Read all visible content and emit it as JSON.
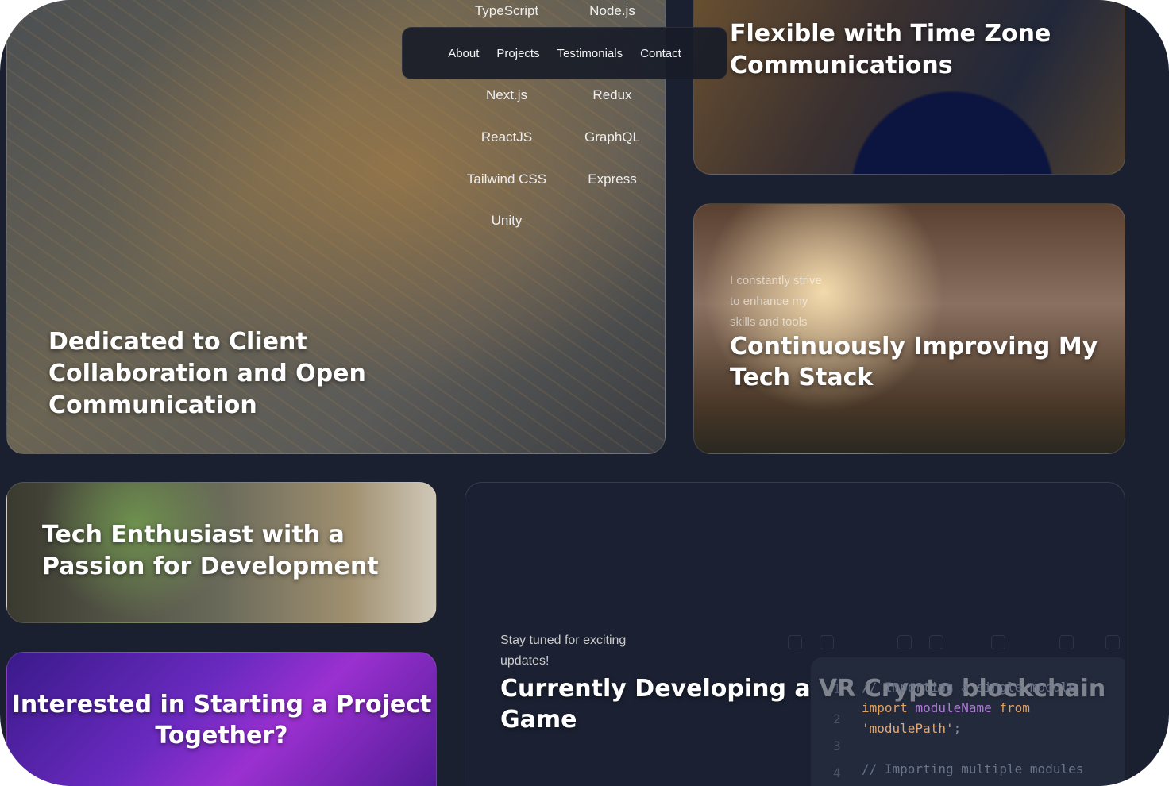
{
  "nav": {
    "items": [
      "About",
      "Projects",
      "Testimonials",
      "Contact"
    ]
  },
  "skills": [
    "TypeScript",
    "Node.js",
    "Next.js",
    "Redux",
    "ReactJS",
    "GraphQL",
    "Tailwind CSS",
    "Express",
    "Unity"
  ],
  "cards": {
    "client": {
      "title": "Dedicated to Client Collaboration and Open Communication"
    },
    "timezone": {
      "title": "Flexible with Time Zone Communications"
    },
    "stack": {
      "subtitle": "I constantly strive to enhance my skills and tools",
      "title": "Continuously Improving My Tech Stack"
    },
    "enthusiast": {
      "title": "Tech Enthusiast with a Passion for Development"
    },
    "cta": {
      "title": "Interested in Starting a Project Together?"
    },
    "vr": {
      "subtitle": "Stay tuned for exciting updates!",
      "title": "Currently Developing a VR Crypto blockchain Game",
      "code": {
        "line_numbers": [
          "1",
          "2",
          "3",
          "4"
        ],
        "line1": "// Importing a single module",
        "kw_import": "import",
        "ident": "moduleName",
        "kw_from": "from",
        "string": "'modulePath'",
        "punct": ";",
        "line4": "// Importing multiple modules"
      }
    }
  }
}
